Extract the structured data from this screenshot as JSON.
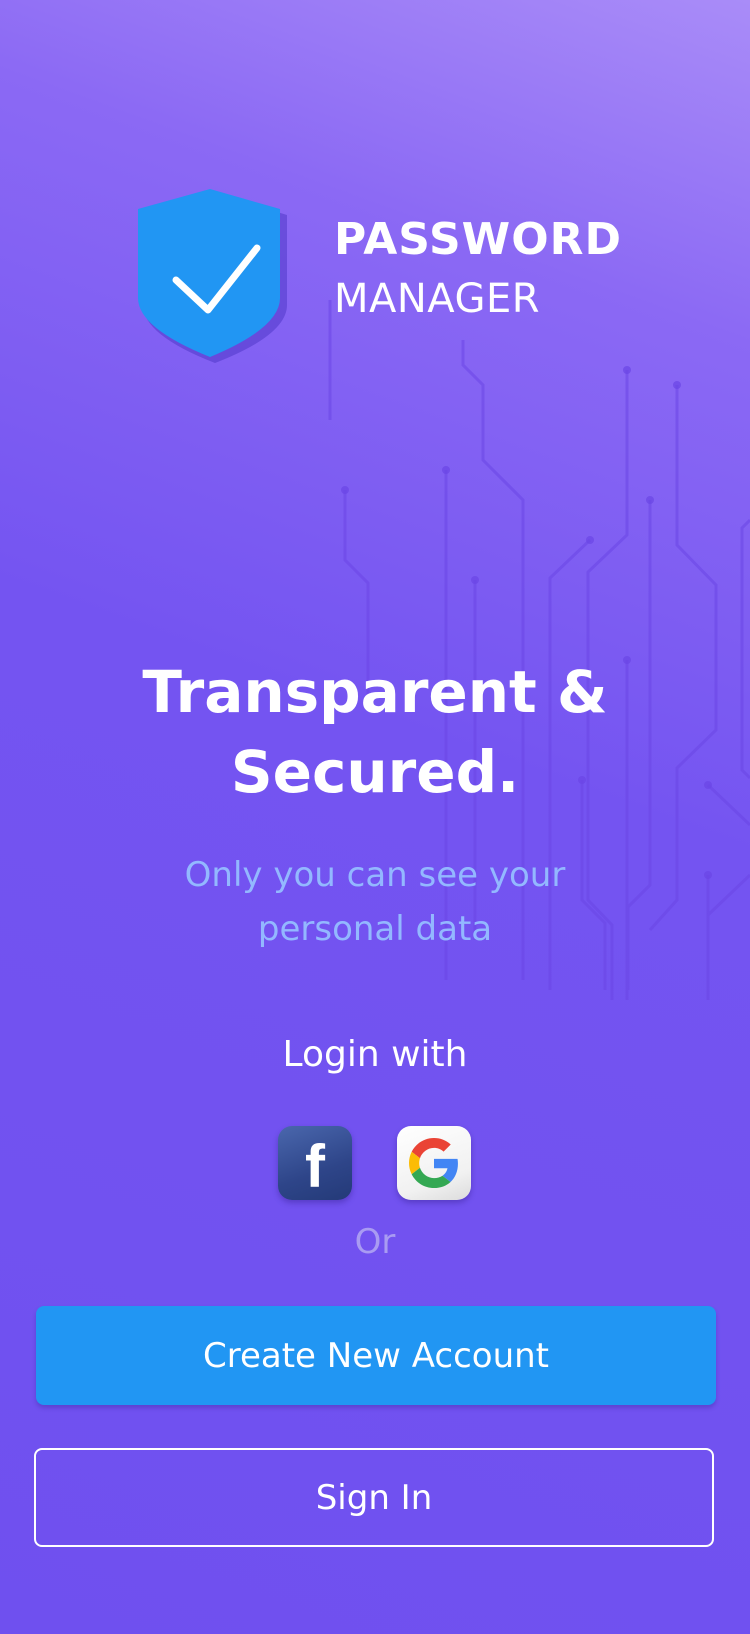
{
  "app": {
    "title_line1": "PASSWORD",
    "title_line2": "MANAGER",
    "logo_icon": "shield-check-icon"
  },
  "hero": {
    "headline_line1": "Transparent &",
    "headline_line2": "Secured.",
    "subtitle_line1": "Only you can see your",
    "subtitle_line2": "personal data"
  },
  "login": {
    "label": "Login with",
    "providers": [
      {
        "name": "Facebook",
        "icon": "facebook-icon"
      },
      {
        "name": "Google",
        "icon": "google-icon"
      }
    ],
    "or_label": "Or"
  },
  "actions": {
    "create_account_label": "Create New Account",
    "sign_in_label": "Sign In"
  },
  "colors": {
    "background_top": "#a98cf8",
    "background_main": "#7454f1",
    "accent_blue": "#2196f3",
    "subtitle_text": "#93b8ff",
    "or_text": "#a99bf2"
  }
}
